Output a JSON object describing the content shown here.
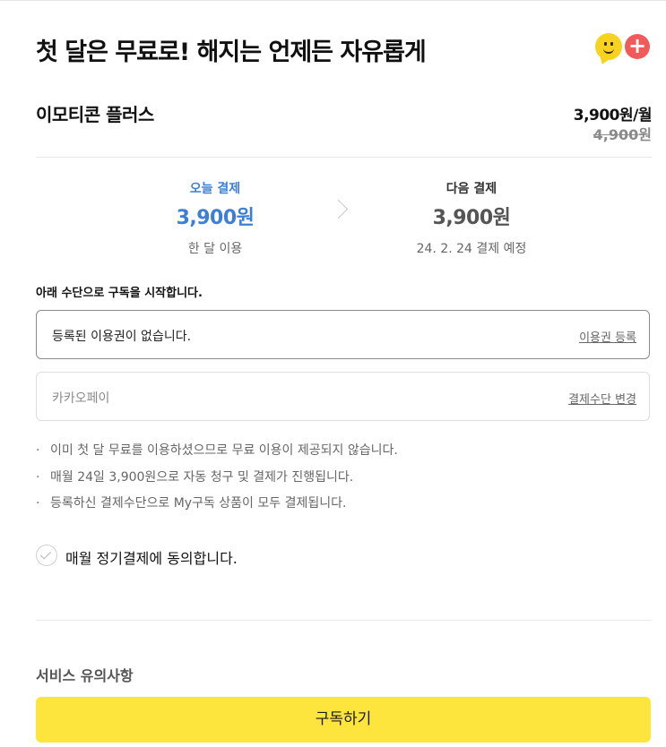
{
  "header": {
    "title": "첫 달은 무료로! 해지는 언제든 자유롭게"
  },
  "product": {
    "name": "이모티콘 플러스",
    "price": "3,900원/월",
    "original_price": "4,900",
    "original_price_unit": "원"
  },
  "billing": {
    "today": {
      "label": "오늘 결제",
      "amount": "3,900원",
      "note": "한 달 이용"
    },
    "next": {
      "label": "다음 결제",
      "amount": "3,900원",
      "note": "24. 2. 24 결제 예정"
    }
  },
  "payment": {
    "title": "아래 수단으로 구독을 시작합니다.",
    "voucher": {
      "value": "등록된 이용권이 없습니다.",
      "action": "이용권 등록"
    },
    "method": {
      "value": "카카오페이",
      "action": "결제수단 변경"
    }
  },
  "notes": [
    "이미 첫 달 무료를 이용하셨으므로 무료 이용이 제공되지 않습니다.",
    "매월 24일 3,900원으로 자동 청구 및 결제가 진행됩니다.",
    "등록하신 결제수단으로 My구독 상품이 모두 결제됩니다."
  ],
  "agreement": {
    "label": "매월 정기결제에 동의합니다.",
    "checked": false
  },
  "service": {
    "title": "서비스 유의사항"
  },
  "cta": {
    "label": "구독하기"
  },
  "colors": {
    "accent_blue": "#3d7fd6",
    "cta_yellow": "#fee53d",
    "plus_red": "#f05a5a"
  },
  "icons": [
    "emoticon-smile-icon",
    "plus-icon",
    "chevron-right-icon",
    "check-circle-icon"
  ]
}
